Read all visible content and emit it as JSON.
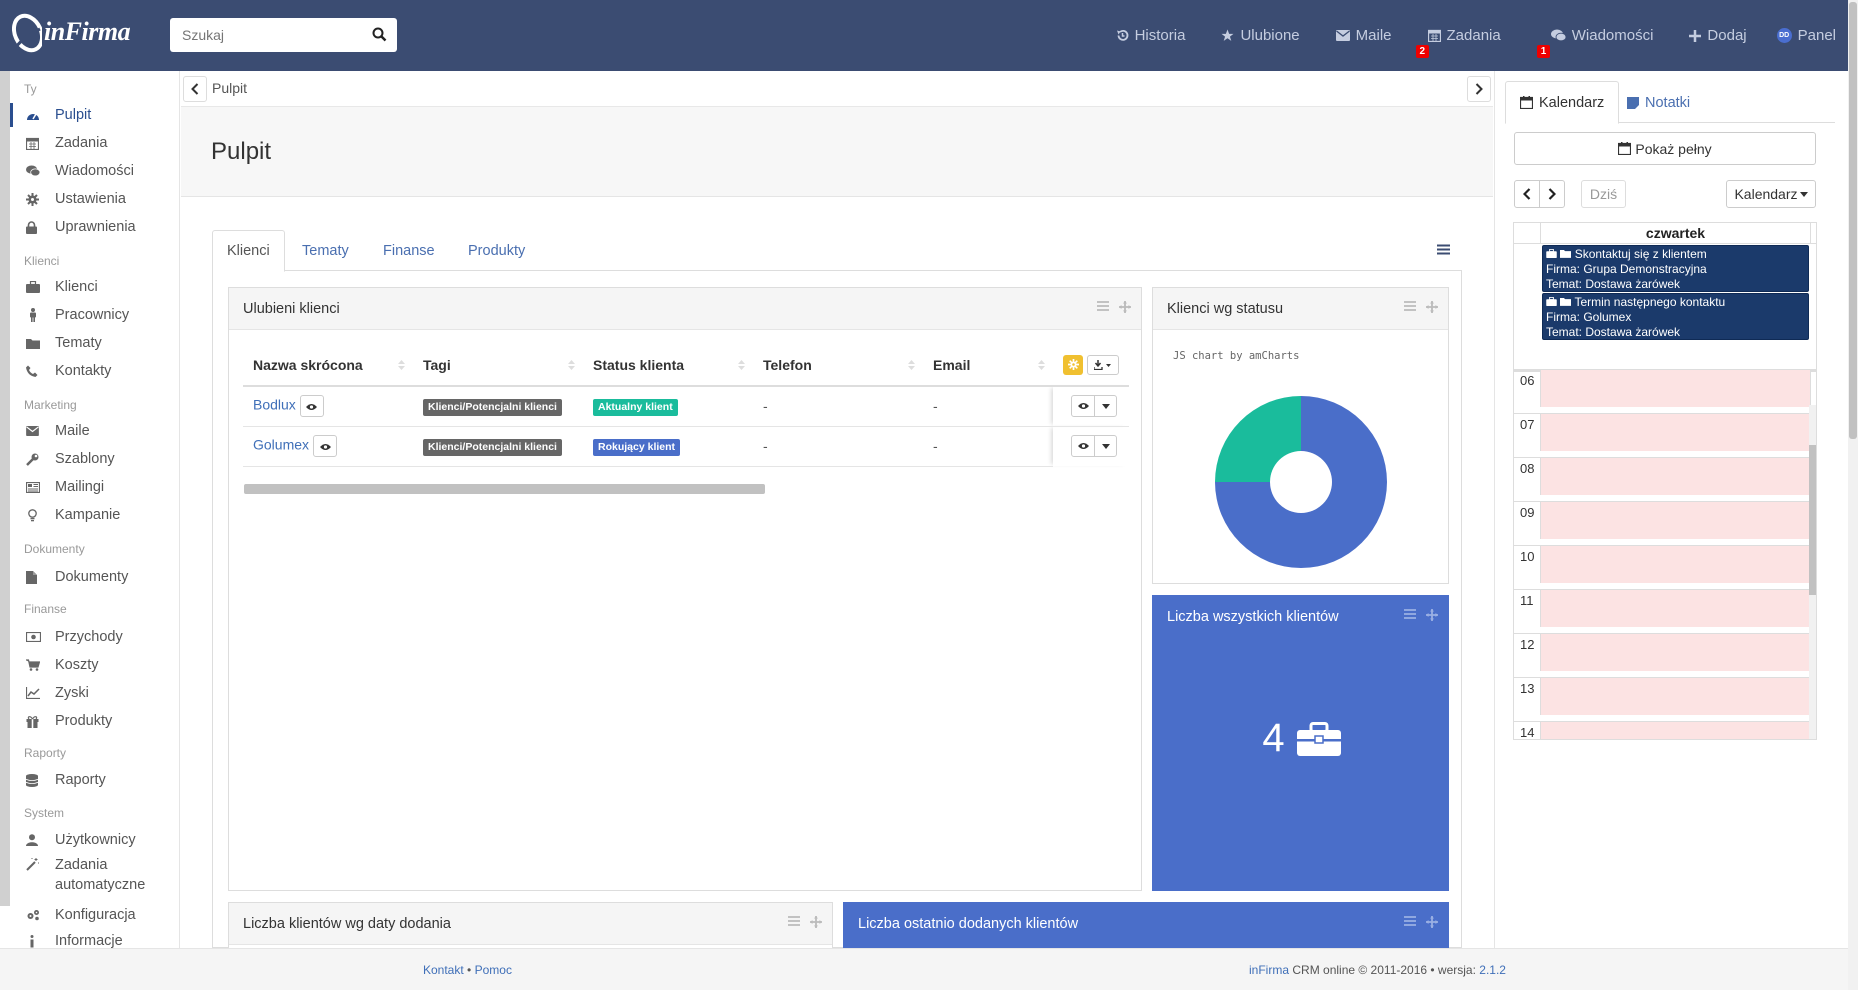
{
  "app": {
    "logo_text": "inFirma"
  },
  "search": {
    "placeholder": "Szukaj"
  },
  "nav": {
    "historia": "Historia",
    "ulubione": "Ulubione",
    "maile": "Maile",
    "zadania": "Zadania",
    "zadania_badge": "2",
    "wiadomosci": "Wiadomości",
    "wiadomosci_badge": "1",
    "dodaj": "Dodaj",
    "panel": "Panel",
    "panel_avatar": "DD"
  },
  "sidebar": {
    "sections": {
      "ty": "Ty",
      "klienci": "Klienci",
      "marketing": "Marketing",
      "dokumenty": "Dokumenty",
      "finanse": "Finanse",
      "raporty": "Raporty",
      "system": "System"
    },
    "items": {
      "pulpit": "Pulpit",
      "zadania": "Zadania",
      "wiadomosci": "Wiadomości",
      "ustawienia": "Ustawienia",
      "uprawnienia": "Uprawnienia",
      "klienci": "Klienci",
      "pracownicy": "Pracownicy",
      "tematy": "Tematy",
      "kontakty": "Kontakty",
      "maile": "Maile",
      "szablony": "Szablony",
      "mailingi": "Mailingi",
      "kampanie": "Kampanie",
      "dokumenty": "Dokumenty",
      "przychody": "Przychody",
      "koszty": "Koszty",
      "zyski": "Zyski",
      "produkty": "Produkty",
      "raporty": "Raporty",
      "uzytkownicy": "Użytkownicy",
      "zadania_auto_1": "Zadania",
      "zadania_auto_2": "automatyczne",
      "konfiguracja": "Konfiguracja",
      "informacje": "Informacje"
    }
  },
  "breadcrumb": {
    "current": "Pulpit"
  },
  "page": {
    "title": "Pulpit"
  },
  "tabs": {
    "klienci": "Klienci",
    "tematy": "Tematy",
    "finanse": "Finanse",
    "produkty": "Produkty"
  },
  "favorites": {
    "title": "Ulubieni klienci",
    "columns": [
      "Nazwa skrócona",
      "Tagi",
      "Status klienta",
      "Telefon",
      "Email"
    ],
    "rows": [
      {
        "name": "Bodlux",
        "tag": "Klienci/Potencjalni klienci",
        "status": "Aktualny klient",
        "status_color": "#1abc9c",
        "phone": "-",
        "email": "-"
      },
      {
        "name": "Golumex",
        "tag": "Klienci/Potencjalni klienci",
        "status": "Rokujący klient",
        "status_color": "#4a6ec9",
        "phone": "-",
        "email": "-"
      }
    ]
  },
  "status_widget": {
    "title": "Klienci wg statusu",
    "credit": "JS chart by amCharts"
  },
  "chart_data": {
    "type": "pie",
    "categories": [
      "Rokujący klient",
      "Aktualny klient"
    ],
    "values": [
      75,
      25
    ],
    "colors": [
      "#4a6ec9",
      "#1abc9c"
    ],
    "donut": true
  },
  "count_widget": {
    "title": "Liczba wszystkich klientów",
    "value": "4"
  },
  "bydate_widget": {
    "title": "Liczba klientów wg daty dodania"
  },
  "recent_widget": {
    "title": "Liczba ostatnio dodanych klientów"
  },
  "right": {
    "tab_kalendarz": "Kalendarz",
    "tab_notatki": "Notatki",
    "show_full": "Pokaż pełny",
    "today": "Dziś",
    "view_select": "Kalendarz",
    "day": "czwartek",
    "events": [
      {
        "title": "Skontaktuj się z klientem",
        "firma": "Firma: Grupa Demonstracyjna",
        "temat": "Temat: Dostawa żarówek"
      },
      {
        "title": "Termin następnego kontaktu",
        "firma": "Firma: Golumex",
        "temat": "Temat: Dostawa żarówek"
      }
    ],
    "hours": [
      "06",
      "07",
      "08",
      "09",
      "10",
      "11",
      "12",
      "13",
      "14"
    ]
  },
  "footer": {
    "kontakt": "Kontakt",
    "sep": "•",
    "pomoc": "Pomoc",
    "brand": "inFirma",
    "copyright": "CRM online © 2011-2016 • wersja:",
    "version": "2.1.2"
  },
  "colors": {
    "navbar": "#3b4c72",
    "accent": "#4a6ec9",
    "event": "#1b3a6b",
    "badge": "#ee0000",
    "widget_blue": "#4a6ec9"
  }
}
